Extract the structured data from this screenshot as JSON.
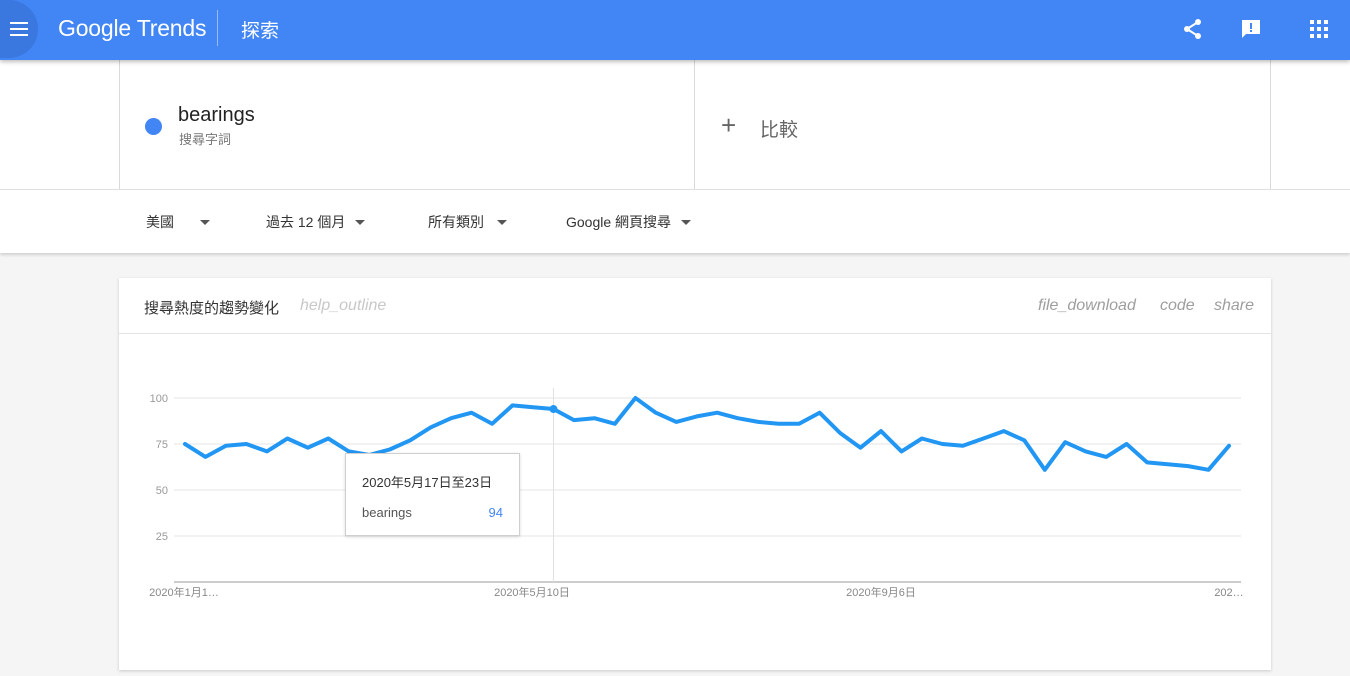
{
  "header": {
    "brand": "Google Trends",
    "section": "探索",
    "icons": [
      "menu-icon",
      "share-icon",
      "feedback-icon",
      "apps-icon"
    ],
    "color": "#4285f4"
  },
  "terms": {
    "term": {
      "name": "bearings",
      "subtitle": "搜尋字詞",
      "color": "#4285f4"
    },
    "compare_label": "比較",
    "compare_symbol": "+"
  },
  "filters": [
    {
      "label": "美國"
    },
    {
      "label": "過去 12 個月"
    },
    {
      "label": "所有類別"
    },
    {
      "label": "Google 網頁搜尋"
    }
  ],
  "card": {
    "title": "搜尋熱度的趨勢變化",
    "help_text": "help_outline",
    "actions": [
      "file_download",
      "code",
      "share"
    ]
  },
  "tooltip": {
    "date": "2020年5月17日至23日",
    "term": "bearings",
    "value": "94"
  },
  "chart_data": {
    "type": "line",
    "y_ticks": [
      "25",
      "50",
      "75",
      "100"
    ],
    "ylim": [
      0,
      100
    ],
    "x_tick_labels": [
      "2020年1月1…",
      "2020年5月10日",
      "2020年9月6日",
      "202…"
    ],
    "grid": true,
    "highlight_index": 18,
    "series": [
      {
        "color": "#2196f3",
        "values": [
          75,
          68,
          74,
          75,
          71,
          78,
          73,
          78,
          71,
          69,
          72,
          77,
          84,
          89,
          92,
          86,
          96,
          95,
          94,
          88,
          89,
          86,
          100,
          92,
          87,
          90,
          92,
          89,
          87,
          86,
          86,
          92,
          81,
          73,
          82,
          71,
          78,
          75,
          74,
          78,
          82,
          77,
          61,
          76,
          71,
          68,
          75,
          65,
          64,
          63,
          61,
          74
        ]
      }
    ]
  }
}
